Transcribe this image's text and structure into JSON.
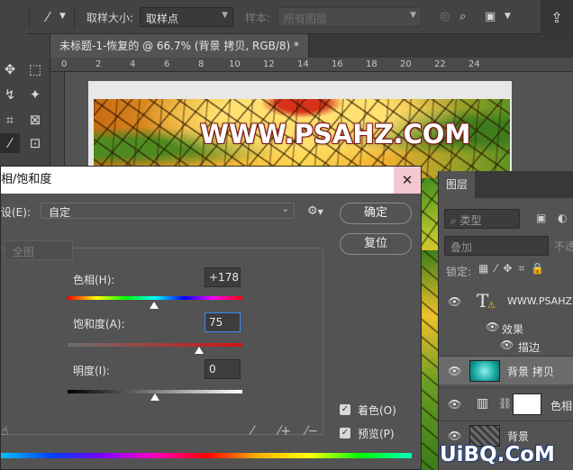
{
  "options_bar": {
    "sample_size_label": "取样大小:",
    "sample_size_value": "取样点",
    "sample_label": "样本:",
    "sample_value": "所有图层"
  },
  "document": {
    "tab_title": "未标题-1-恢复的 @ 66.7% (背景 拷贝, RGB/8) *",
    "ruler_ticks": [
      "0",
      "2",
      "4",
      "6",
      "8",
      "10",
      "12",
      "14",
      "16",
      "18",
      "20",
      "22",
      "24"
    ],
    "canvas_text": "WWW.PSAHZ.COM"
  },
  "layers_panel": {
    "tab_label": "图层",
    "search_placeholder": "类型",
    "blend_mode": "叠加",
    "opacity_label": "不透",
    "lock_label": "锁定:",
    "layers": [
      {
        "name": "WWW.PSAHZ.COM",
        "type": "text"
      },
      {
        "name": "背景 拷贝",
        "selected": true
      },
      {
        "name": "色相",
        "type": "adjustment"
      },
      {
        "name": "背景"
      }
    ],
    "effects_label": "效果",
    "stroke_label": "描边"
  },
  "dialog": {
    "title": "相/饱和度",
    "preset_label": "设(E):",
    "preset_value": "自定",
    "ok_label": "确定",
    "reset_label": "复位",
    "channel_value": "全图",
    "hue_label": "色相(H):",
    "hue_value": "+178",
    "hue_position": 0.494,
    "saturation_label": "饱和度(A):",
    "saturation_value": "75",
    "saturation_position": 0.75,
    "lightness_label": "明度(I):",
    "lightness_value": "0",
    "lightness_position": 0.5,
    "colorize_label": "着色(O)",
    "colorize_checked": true,
    "preview_label": "预览(P)",
    "preview_checked": true
  },
  "brand": "UiBQ.CoM"
}
